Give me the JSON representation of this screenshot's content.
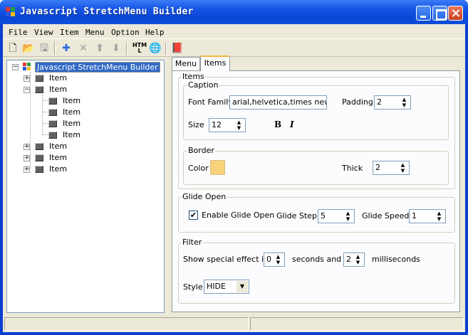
{
  "window": {
    "title": "Javascript StretchMenu Builder"
  },
  "menubar": [
    "File",
    "View",
    "Item",
    "Menu",
    "Option",
    "Help"
  ],
  "toolbar": [
    {
      "icon": "new-icon",
      "glyph": "🗋"
    },
    {
      "icon": "open-icon",
      "glyph": "📂"
    },
    {
      "icon": "save-icon",
      "glyph": "🖫"
    },
    {
      "icon": "add-icon",
      "glyph": "✚"
    },
    {
      "icon": "delete-icon",
      "glyph": "✕"
    },
    {
      "icon": "move-up-icon",
      "glyph": "⬆"
    },
    {
      "icon": "move-down-icon",
      "glyph": "⬇"
    },
    {
      "icon": "html-icon",
      "glyph": "HTML"
    },
    {
      "icon": "preview-icon",
      "glyph": "🌐"
    },
    {
      "icon": "help-book-icon",
      "glyph": "📕"
    }
  ],
  "tree": {
    "root": "Javascript StretchMenu Builder",
    "items": [
      {
        "label": "Item",
        "expander": "+"
      },
      {
        "label": "Item",
        "expander": "−"
      },
      {
        "label": "Item",
        "expander": ""
      },
      {
        "label": "Item",
        "expander": ""
      },
      {
        "label": "Item",
        "expander": ""
      },
      {
        "label": "Item",
        "expander": ""
      },
      {
        "label": "Item",
        "expander": "+"
      },
      {
        "label": "Item",
        "expander": "+"
      },
      {
        "label": "Item",
        "expander": "+"
      }
    ]
  },
  "tabs": [
    "Menu",
    "Items"
  ],
  "items_panel": {
    "group_title": "Items",
    "caption": {
      "title": "Caption",
      "font_family_label": "Font Family",
      "font_family_value": "arial,helvetica,times new ror",
      "padding_label": "Padding",
      "padding_value": "2",
      "size_label": "Size",
      "size_value": "12",
      "bold_label": "B",
      "italic_label": "I"
    },
    "border": {
      "title": "Border",
      "color_label": "Color",
      "color_value": "#f8d27a",
      "thick_label": "Thick",
      "thick_value": "2"
    }
  },
  "glide_open": {
    "title": "Glide Open",
    "enable_label": "Enable Glide Open",
    "enabled": true,
    "step_label": "Glide Step",
    "step_value": "5",
    "speed_label": "Glide Speed",
    "speed_value": "1"
  },
  "filter": {
    "title": "Filter",
    "prefix": "Show special effect in",
    "seconds_value": "0",
    "middle": "seconds and",
    "ms_value": "2",
    "suffix": "milliseconds",
    "style_label": "Style",
    "style_value": "HIDE"
  },
  "colors": {
    "titlebar": "#0a47d6",
    "selected": "#316ac5",
    "face": "#ece9d8"
  }
}
